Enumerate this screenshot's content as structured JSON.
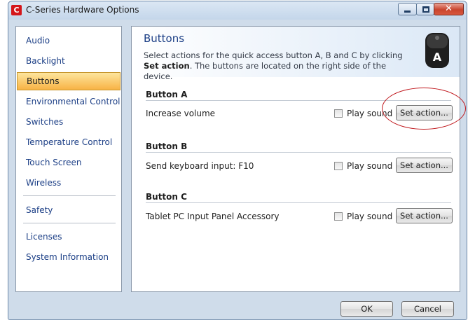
{
  "window": {
    "title": "C-Series Hardware Options",
    "app_icon_letter": "C",
    "close_glyph": "✕"
  },
  "sidebar": {
    "items": [
      {
        "label": "Audio"
      },
      {
        "label": "Backlight"
      },
      {
        "label": "Buttons",
        "selected": true
      },
      {
        "label": "Environmental Control"
      },
      {
        "label": "Switches"
      },
      {
        "label": "Temperature Control"
      },
      {
        "label": "Touch Screen"
      },
      {
        "label": "Wireless"
      },
      {
        "label": "Safety"
      },
      {
        "label": "Licenses"
      },
      {
        "label": "System Information"
      }
    ]
  },
  "content": {
    "title": "Buttons",
    "description_part1": "Select actions for the quick access button A, B and C by clicking ",
    "description_bold": "Set action",
    "description_part2": ". The buttons are located on the right side of the device.",
    "device_icon_letter": "A",
    "buttons": [
      {
        "title": "Button A",
        "action": "Increase volume",
        "play_sound_label": "Play sound",
        "play_sound_checked": false,
        "set_action_label": "Set action..."
      },
      {
        "title": "Button B",
        "action": "Send keyboard input: F10",
        "play_sound_label": "Play sound",
        "play_sound_checked": false,
        "set_action_label": "Set action..."
      },
      {
        "title": "Button C",
        "action": "Tablet PC Input Panel Accessory",
        "play_sound_label": "Play sound",
        "play_sound_checked": false,
        "set_action_label": "Set action..."
      }
    ]
  },
  "footer": {
    "ok_label": "OK",
    "cancel_label": "Cancel"
  },
  "colors": {
    "accent_link": "#1c3f86",
    "selection": "#f8b345",
    "highlight_ring": "#c0181d"
  }
}
